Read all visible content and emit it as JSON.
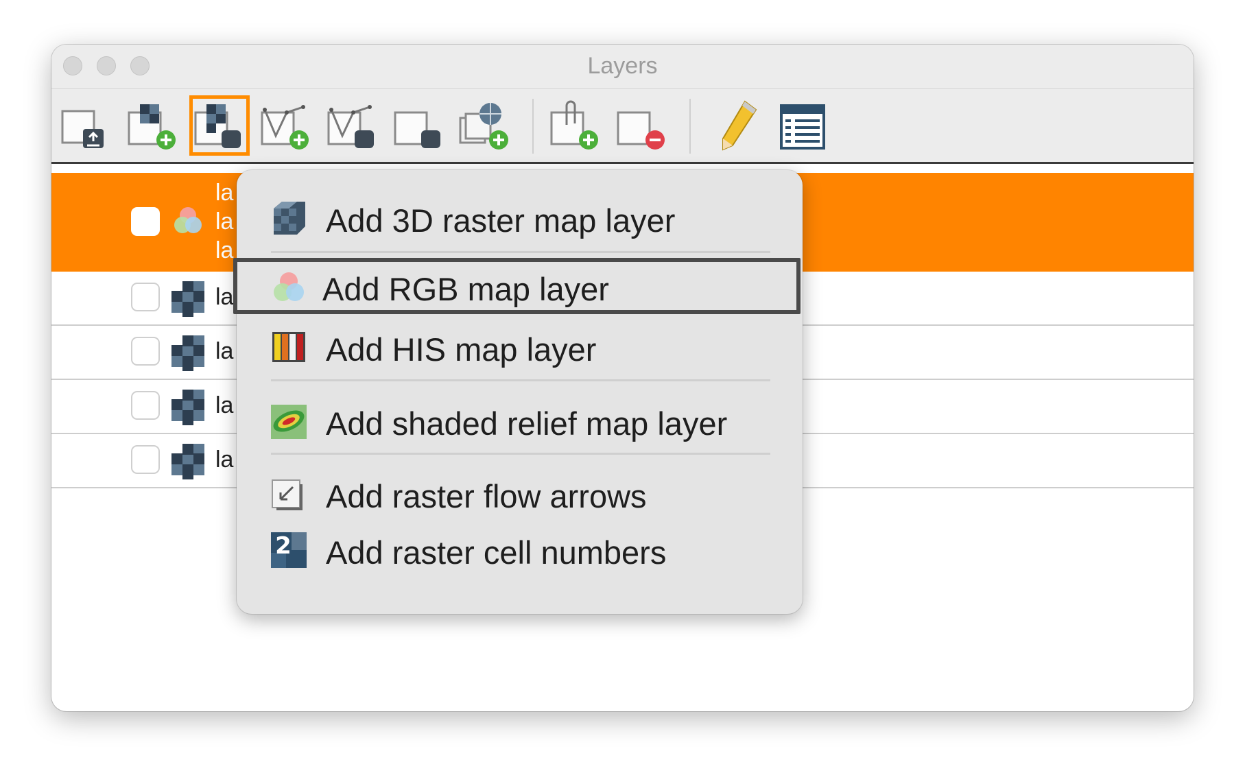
{
  "window": {
    "title": "Layers"
  },
  "toolbar": {
    "buttons": [
      {
        "name": "import-layer-icon"
      },
      {
        "name": "add-raster-layer-icon"
      },
      {
        "name": "add-raster-misc-icon",
        "active": true
      },
      {
        "name": "add-vector-layer-icon"
      },
      {
        "name": "add-vector-misc-icon"
      },
      {
        "name": "add-misc-layer-icon"
      },
      {
        "name": "add-web-service-layer-icon"
      },
      {
        "name": "add-group-icon"
      },
      {
        "name": "remove-layer-icon"
      },
      {
        "name": "edit-pencil-icon"
      },
      {
        "name": "attribute-table-icon"
      }
    ]
  },
  "layers": [
    {
      "label_lines": [
        "la",
        "la",
        "la"
      ],
      "icon": "rgb-icon",
      "selected": true
    },
    {
      "label": "la",
      "icon": "raster-icon"
    },
    {
      "label": "la",
      "icon": "raster-icon"
    },
    {
      "label": "la",
      "icon": "raster-icon"
    },
    {
      "label": "la",
      "icon": "raster-icon"
    }
  ],
  "menu": {
    "items": [
      {
        "label": "Add 3D raster map layer",
        "icon": "raster-3d-icon"
      },
      {
        "label": "Add RGB map layer",
        "icon": "rgb-circles-icon",
        "highlighted": true
      },
      {
        "label": "Add HIS map layer",
        "icon": "his-bars-icon"
      },
      {
        "label": "Add shaded relief map layer",
        "icon": "shaded-relief-icon"
      },
      {
        "label": "Add raster flow arrows",
        "icon": "flow-arrows-icon"
      },
      {
        "label": "Add raster cell numbers",
        "icon": "cell-numbers-icon"
      }
    ],
    "cell_numbers_glyph": "2"
  },
  "colors": {
    "selection": "#ff8400",
    "active_outline": "#ff8c00",
    "add_badge": "#4caf3a",
    "remove_badge": "#e0404a"
  }
}
